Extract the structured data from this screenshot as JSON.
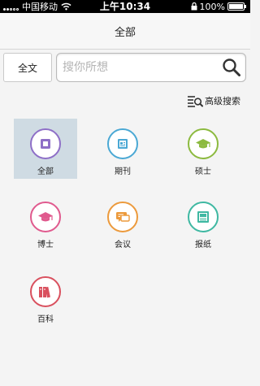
{
  "status_bar": {
    "carrier": "中国移动",
    "time": "上午10:34",
    "battery": "100%"
  },
  "nav": {
    "title": "全部"
  },
  "search": {
    "scope_label": "全文",
    "placeholder": "搜你所想",
    "value": ""
  },
  "advanced_search": {
    "label": "高级搜索"
  },
  "categories": [
    {
      "label": "全部",
      "icon": "book-icon",
      "color": "#8e6fc7",
      "selected": true
    },
    {
      "label": "期刊",
      "icon": "journal-icon",
      "color": "#4aa8d4",
      "selected": false
    },
    {
      "label": "硕士",
      "icon": "graduation-cap-icon",
      "color": "#8cba3f",
      "selected": false
    },
    {
      "label": "博士",
      "icon": "graduation-cap-icon",
      "color": "#e05a8e",
      "selected": false
    },
    {
      "label": "会议",
      "icon": "chat-icon",
      "color": "#ec9a3c",
      "selected": false
    },
    {
      "label": "报纸",
      "icon": "newspaper-icon",
      "color": "#3fb8a2",
      "selected": false
    },
    {
      "label": "百科",
      "icon": "books-icon",
      "color": "#d9505e",
      "selected": false
    }
  ]
}
